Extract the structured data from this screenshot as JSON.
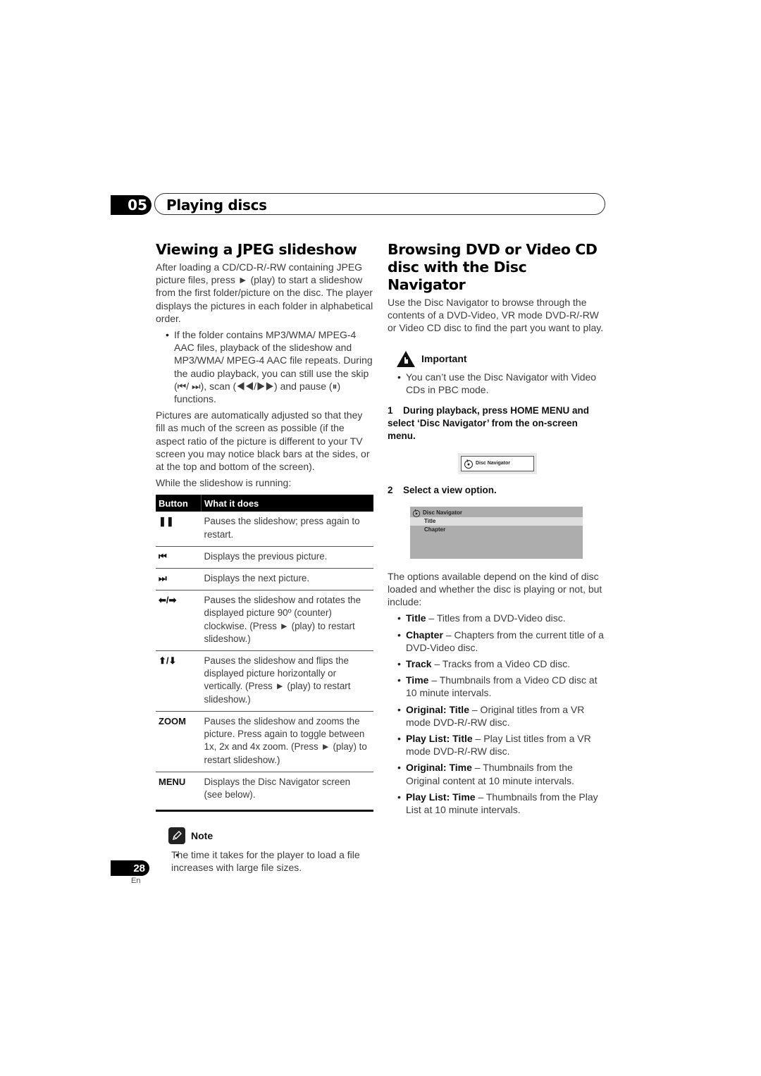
{
  "header": {
    "chapter_number": "05",
    "chapter_title": "Playing discs"
  },
  "left": {
    "heading": "Viewing a JPEG slideshow",
    "intro": "After loading a CD/CD-R/-RW containing JPEG picture files, press ► (play) to start a slideshow from the first folder/picture on the disc. The player displays the pictures in each folder in alphabetical order.",
    "bullet": "If the folder contains MP3/WMA/ MPEG-4 AAC files, playback of the slideshow and MP3/WMA/ MPEG-4 AAC file repeats. During the audio playback, you can still use the skip (⏮/ ⏭), scan (◀◀/▶▶) and pause (⏸) functions.",
    "para2": "Pictures are automatically adjusted so that they fill as much of the screen as possible (if the aspect ratio of the picture is different to your TV screen you may notice black bars at the sides, or at the top and bottom of the screen).",
    "para3": "While the slideshow is running:",
    "table": {
      "headers": [
        "Button",
        "What it does"
      ],
      "rows": [
        {
          "button": "❚❚",
          "icon": "pause-icon",
          "desc": "Pauses the slideshow; press again to restart."
        },
        {
          "button": "⏮",
          "icon": "previous-icon",
          "desc": "Displays the previous picture."
        },
        {
          "button": "⏭",
          "icon": "next-icon",
          "desc": "Displays the next picture."
        },
        {
          "button": "⬅/➡",
          "icon": "left-right-arrow-icon",
          "desc": "Pauses the slideshow and rotates the displayed picture 90º (counter) clockwise. (Press ► (play) to restart slideshow.)"
        },
        {
          "button": "⬆/⬇",
          "icon": "up-down-arrow-icon",
          "desc": "Pauses the slideshow and flips the displayed picture horizontally or vertically. (Press ► (play) to restart slideshow.)"
        },
        {
          "button": "ZOOM",
          "icon": "",
          "desc": "Pauses the slideshow and zooms the picture. Press again to toggle between 1x, 2x and 4x zoom. (Press ► (play) to restart slideshow.)"
        },
        {
          "button": "MENU",
          "icon": "",
          "desc": "Displays the Disc Navigator screen (see below)."
        }
      ]
    },
    "note": {
      "label": "Note",
      "icon": "pencil-icon",
      "text": "The time it takes for the player to load a file increases with large file sizes."
    }
  },
  "right": {
    "heading": "Browsing DVD or Video CD disc with the Disc Navigator",
    "intro": "Use the Disc Navigator to browse through the contents of a DVD-Video, VR mode DVD-R/-RW or Video CD disc to find the part you want to play.",
    "important": {
      "label": "Important",
      "icon": "warning-hand-icon",
      "text": "You can’t use the Disc Navigator with Video CDs in PBC mode."
    },
    "step1": {
      "num": "1",
      "text": "During playback, press HOME MENU and select ‘Disc Navigator’ from the on-screen menu."
    },
    "osd1": {
      "label": "Disc Navigator",
      "icon": "disc-icon"
    },
    "step2": {
      "num": "2",
      "text": "Select a view option."
    },
    "osd2": {
      "title": "Disc Navigator",
      "items": [
        "Title",
        "Chapter"
      ],
      "selected": "Title"
    },
    "para": "The options available depend on the kind of disc loaded and whether the disc is playing or not, but include:",
    "options": [
      {
        "term": "Title",
        "desc": " – Titles from a DVD-Video disc."
      },
      {
        "term": "Chapter",
        "desc": " – Chapters from the current title of a DVD-Video disc."
      },
      {
        "term": "Track",
        "desc": " – Tracks from a Video CD disc."
      },
      {
        "term": "Time",
        "desc": " – Thumbnails from a Video CD disc at 10 minute intervals."
      },
      {
        "term": "Original: Title",
        "desc": " – Original titles from a VR mode DVD-R/-RW disc."
      },
      {
        "term": "Play List: Title",
        "desc": " – Play List titles from a VR mode DVD-R/-RW disc."
      },
      {
        "term": "Original: Time",
        "desc": " – Thumbnails from the Original content at 10 minute intervals."
      },
      {
        "term": "Play List: Time",
        "desc": " – Thumbnails from the Play List at 10 minute intervals."
      }
    ]
  },
  "footer": {
    "page_number": "28",
    "language": "En"
  }
}
